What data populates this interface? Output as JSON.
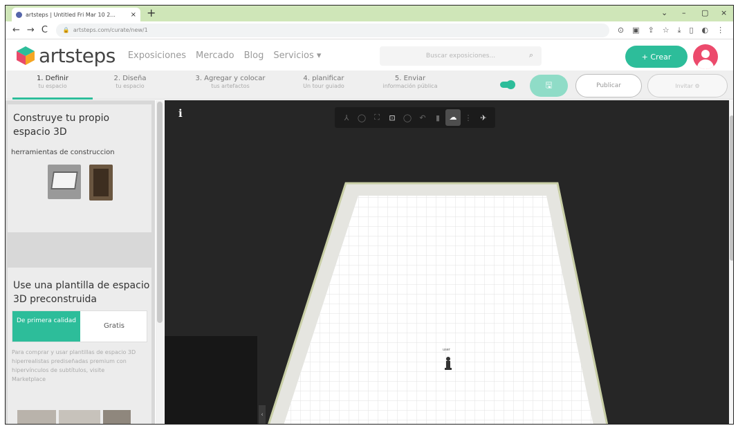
{
  "browser": {
    "tab_title": "artsteps | Untitled Fri Mar 10 2...",
    "tab_close": "×",
    "new_tab": "+",
    "url": "artsteps.com/curate/new/1",
    "window_controls": [
      "⌄",
      "–",
      "▢",
      "×"
    ],
    "nav_icons": [
      "←",
      "→",
      "C"
    ],
    "extension_icons": [
      "⊙",
      "▣",
      "⇪",
      "☆",
      "⤓",
      "▯",
      "◐",
      "⋮"
    ]
  },
  "header": {
    "logo_text": "artsteps",
    "nav": [
      "Exposiciones",
      "Mercado",
      "Blog",
      "Servicios ▾"
    ],
    "search_placeholder": "Buscar exposiciones...",
    "search_icon": "⌕",
    "create_label": "+ Crear"
  },
  "steps": [
    {
      "title": "1. Definir",
      "subtitle": "tu espacio"
    },
    {
      "title": "2. Diseña",
      "subtitle": "tu espacio"
    },
    {
      "title": "3. Agregar y colocar",
      "subtitle": "tus artefactos"
    },
    {
      "title": "4. planificar",
      "subtitle": "Un tour guiado"
    },
    {
      "title": "5. Enviar",
      "subtitle": "información pública"
    }
  ],
  "actions": {
    "save_icon": "🖫",
    "publish_label": "Publicar",
    "ghost_label": "Invitar ⚙"
  },
  "left_panel": {
    "build_title": "Construye tu propio espacio 3D",
    "build_tools_label": "herramientas de construccion",
    "template_title": "Use una plantilla de espacio 3D preconstruida",
    "seg_premium": "De primera calidad",
    "seg_free": "Gratis",
    "template_desc": "Para comprar y usar plantillas de espacio 3D hiperrealistas prediseñadas premium con hipervínculos de subtítulos, visite Marketplace"
  },
  "viewport": {
    "info_icon": "i",
    "tools": [
      "⅄",
      "◯",
      "⛶",
      "⊡",
      "◯",
      "↶",
      "▮",
      "☁",
      "⋮",
      "✈"
    ],
    "collapse_icon": "‹",
    "avatar_label": "user"
  },
  "colors": {
    "accent": "#2dbd9a",
    "avatar": "#ec4a6c",
    "tabbar": "#cfe6b8",
    "viewport_bg": "#262626"
  }
}
